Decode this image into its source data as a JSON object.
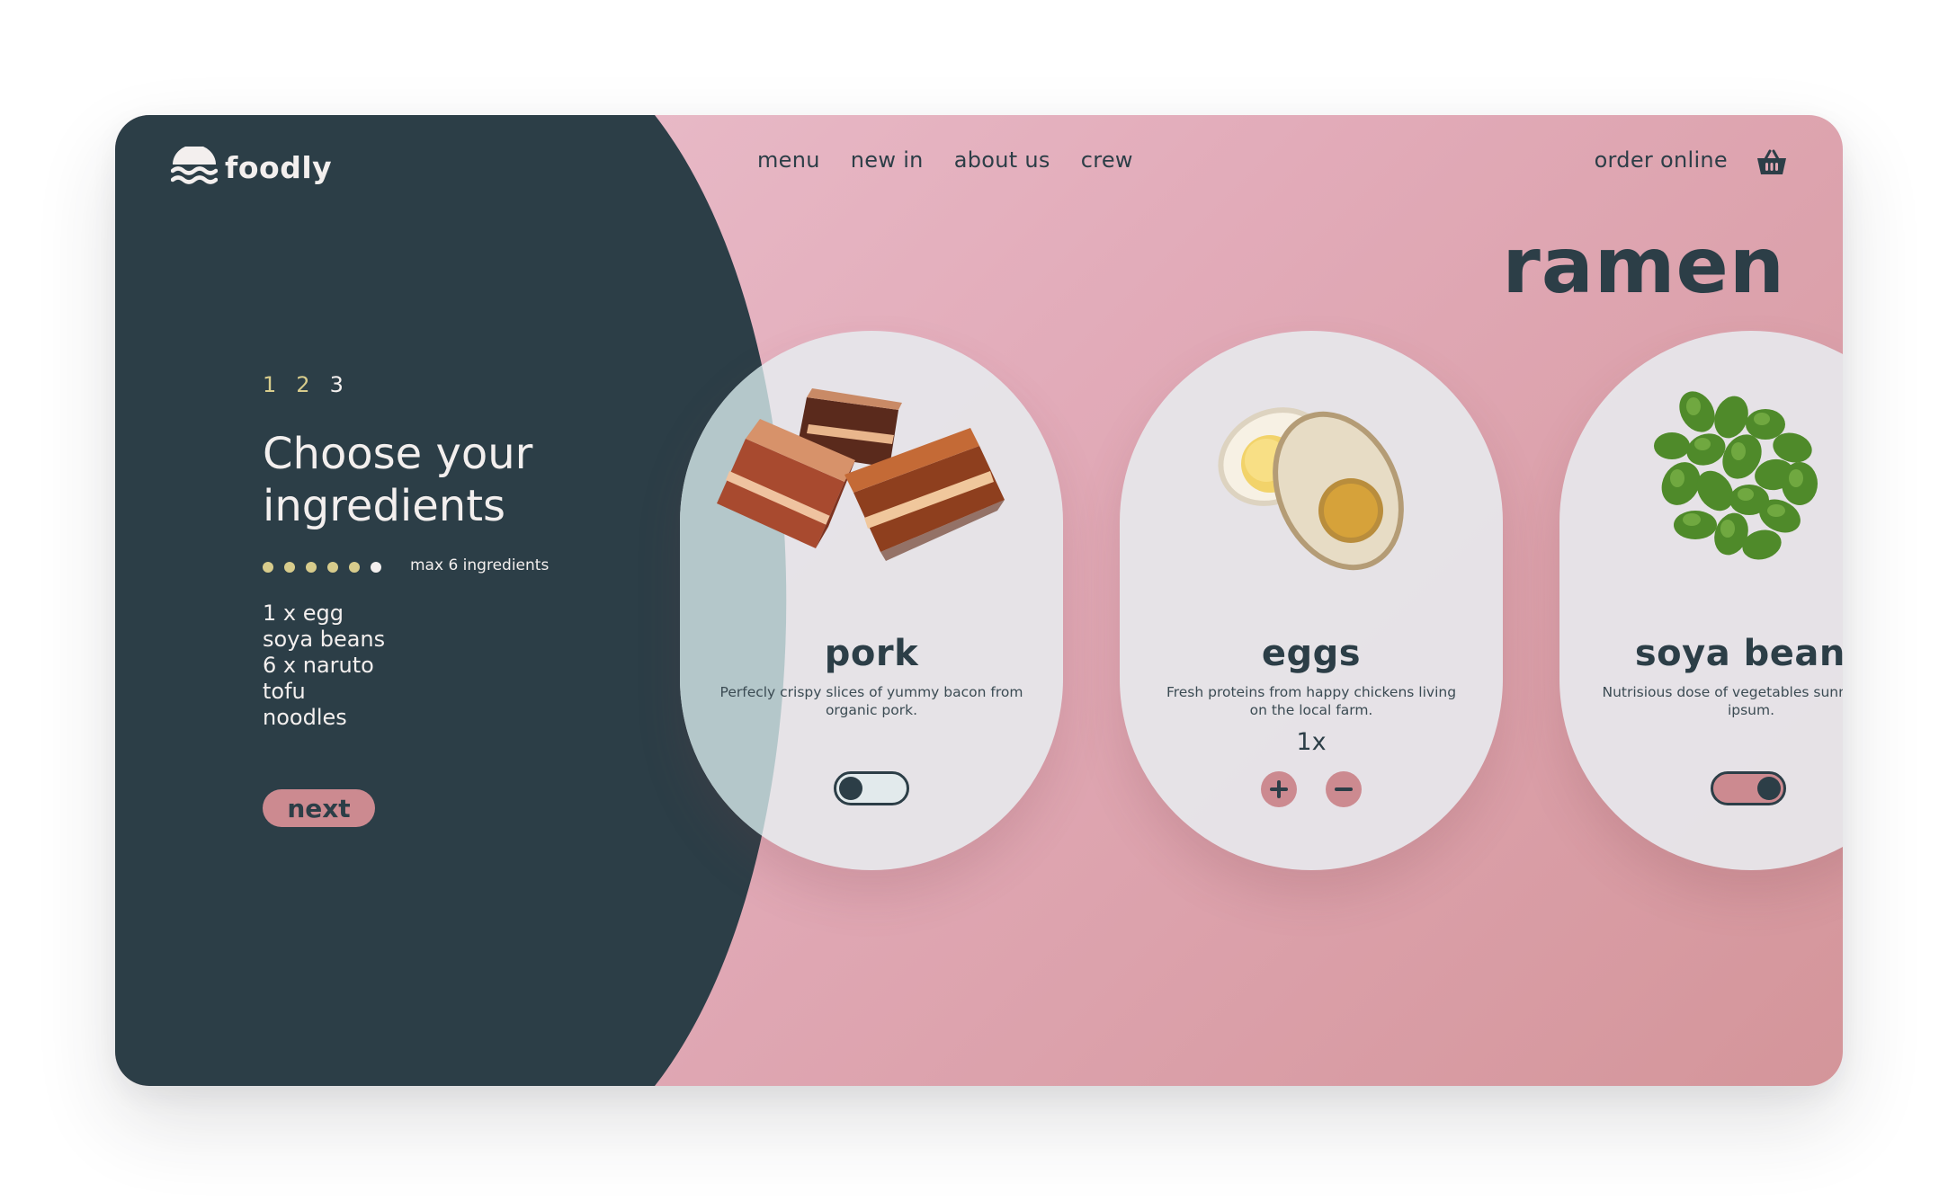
{
  "brand": {
    "name": "foodly"
  },
  "nav": {
    "items": [
      "menu",
      "new in",
      "about us",
      "crew"
    ]
  },
  "header": {
    "order_label": "order online"
  },
  "hero": {
    "title": "ramen"
  },
  "steps": [
    "1",
    "2",
    "3"
  ],
  "left_panel": {
    "title": "Choose your ingredients",
    "max_label": "max 6 ingredients",
    "ingredient_count_selected": 5,
    "ingredient_count_max": 6,
    "selected_list": [
      "1 x egg",
      "soya beans",
      "6 x naruto",
      "tofu",
      "noodles"
    ],
    "next_label": "next"
  },
  "ingredients": [
    {
      "name": "pork",
      "description": "Perfecly crispy slices of yummy bacon from organic pork.",
      "control": "toggle",
      "selected": false
    },
    {
      "name": "eggs",
      "description": "Fresh proteins from happy chickens living on the local farm.",
      "control": "quantity",
      "quantity": "1x"
    },
    {
      "name": "soya beans",
      "description": "Nutrisious dose of vegetables sunny lorem ipsum.",
      "control": "toggle",
      "selected": true
    }
  ],
  "colors": {
    "dark": "#2c3e47",
    "pink_accent": "#cc8a90",
    "cream_text": "#f3efee",
    "gold": "#d8cc8c"
  }
}
